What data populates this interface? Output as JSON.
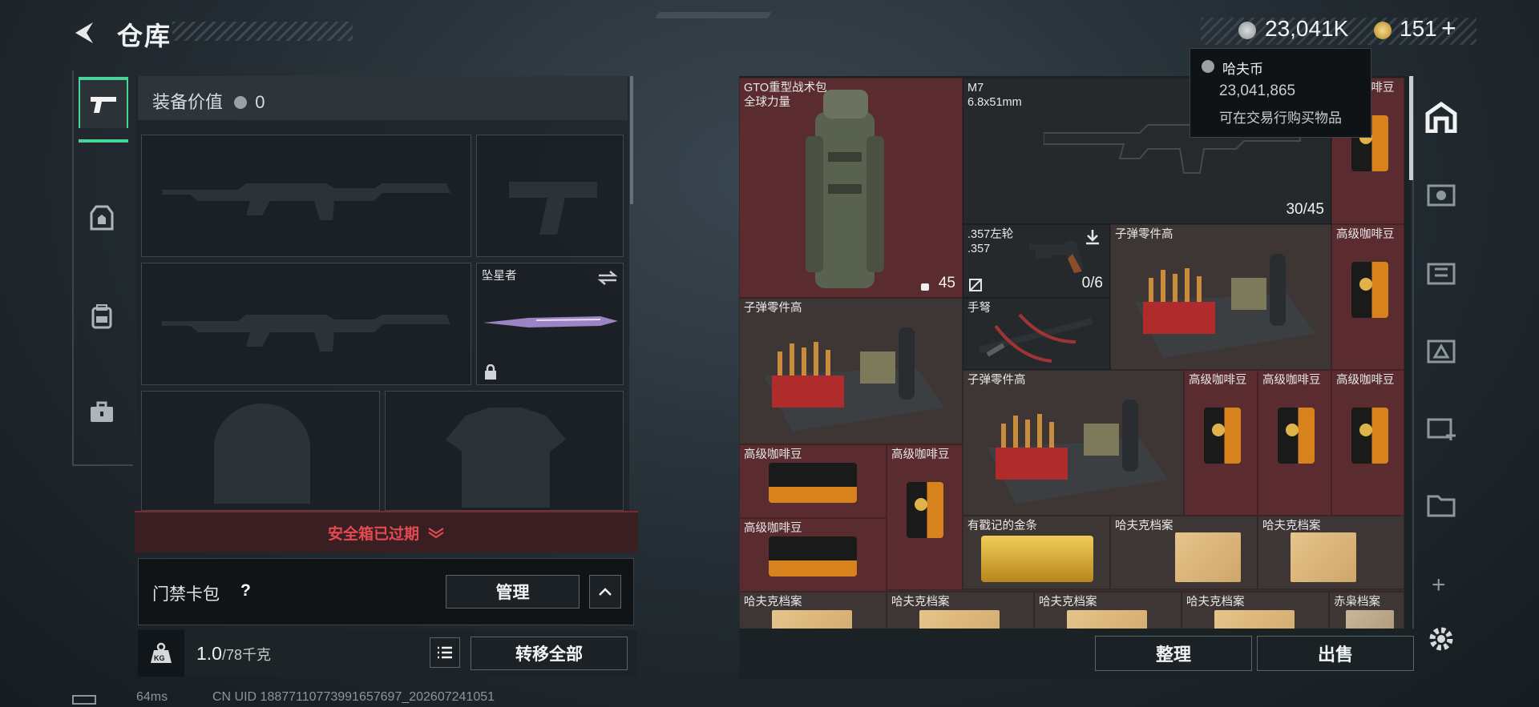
{
  "header": {
    "title": "仓库"
  },
  "currency": {
    "havcoin": "23,041K",
    "premium": "151",
    "add_label": "+"
  },
  "tooltip": {
    "name": "哈夫币",
    "amount": "23,041,865",
    "desc": "可在交易行购买物品"
  },
  "equipment": {
    "value_label": "装备价值",
    "value": "0",
    "melee_name": "坠星者"
  },
  "safe_box": {
    "label": "安全箱已过期"
  },
  "card_pack": {
    "label": "门禁卡包",
    "help": "?",
    "manage_label": "管理"
  },
  "weight": {
    "current": "1.0",
    "max": "/78千克",
    "icon_label": "KG",
    "transfer_label": "转移全部"
  },
  "inventory": {
    "backpack": {
      "name": "GTO重型战术包\n全球力量",
      "count": "45"
    },
    "m7": {
      "name": "M7\n6.8x51mm",
      "count": "30/45"
    },
    "revolver": {
      "name": ".357左轮\n.357",
      "count": "0/6"
    },
    "ammo_parts_label": "子弹零件高",
    "crossbow": {
      "name": "手弩"
    },
    "coffee_label": "高级咖啡豆",
    "gold": {
      "name": "有戳记的金条"
    },
    "archive_label": "哈夫克档案",
    "owl_label": "赤枭档案"
  },
  "actions": {
    "sort_label": "整理",
    "sell_label": "出售"
  },
  "right_tabs": {
    "add": "+"
  },
  "status": {
    "ping": "64ms",
    "uid": "CN UID 18877110773991657697_202607241051"
  },
  "colors": {
    "accent": "#49d29a",
    "danger": "#e54a52",
    "item_red": "#5a2c30"
  }
}
